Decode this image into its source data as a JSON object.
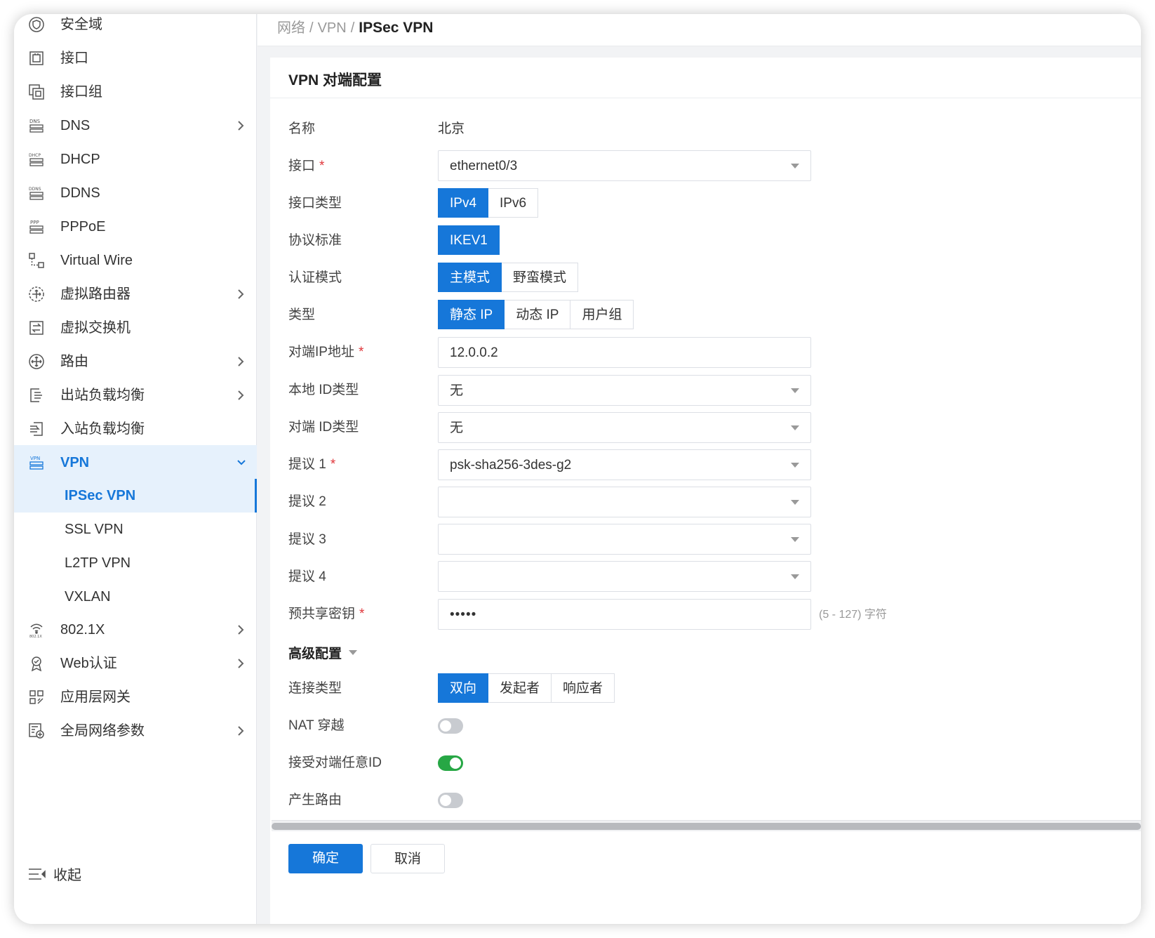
{
  "sidebar": {
    "items": [
      {
        "label": "安全域",
        "icon": "shield-icon"
      },
      {
        "label": "接口",
        "icon": "interface-icon"
      },
      {
        "label": "接口组",
        "icon": "interface-group-icon"
      },
      {
        "label": "DNS",
        "icon": "dns-icon"
      },
      {
        "label": "DHCP",
        "icon": "dhcp-icon"
      },
      {
        "label": "DDNS",
        "icon": "ddns-icon"
      },
      {
        "label": "PPPoE",
        "icon": "pppoe-icon"
      },
      {
        "label": "Virtual Wire",
        "icon": "virtual-wire-icon"
      },
      {
        "label": "虚拟路由器",
        "icon": "virtual-router-icon"
      },
      {
        "label": "虚拟交换机",
        "icon": "virtual-switch-icon"
      },
      {
        "label": "路由",
        "icon": "routing-icon"
      },
      {
        "label": "出站负载均衡",
        "icon": "outbound-lb-icon"
      },
      {
        "label": "入站负载均衡",
        "icon": "inbound-lb-icon"
      },
      {
        "label": "VPN",
        "icon": "vpn-icon"
      },
      {
        "label": "802.1X",
        "icon": "wifi-8021x-icon"
      },
      {
        "label": "Web认证",
        "icon": "web-auth-icon"
      },
      {
        "label": "应用层网关",
        "icon": "app-gateway-icon"
      },
      {
        "label": "全局网络参数",
        "icon": "global-params-icon"
      }
    ],
    "vpn_sub": [
      {
        "label": "IPSec VPN"
      },
      {
        "label": "SSL VPN"
      },
      {
        "label": "L2TP VPN"
      },
      {
        "label": "VXLAN"
      }
    ],
    "collapse_label": "收起"
  },
  "breadcrumb": {
    "part1": "网络",
    "sep": "/",
    "part2": "VPN",
    "current": "IPSec VPN"
  },
  "panel": {
    "title": "VPN 对端配置"
  },
  "form": {
    "name": {
      "label": "名称",
      "value": "北京"
    },
    "interface": {
      "label": "接口",
      "value": "ethernet0/3"
    },
    "interface_type": {
      "label": "接口类型",
      "options": [
        "IPv4",
        "IPv6"
      ],
      "selected": "IPv4"
    },
    "protocol": {
      "label": "协议标准",
      "options": [
        "IKEV1"
      ],
      "selected": "IKEV1"
    },
    "auth_mode": {
      "label": "认证模式",
      "options": [
        "主模式",
        "野蛮模式"
      ],
      "selected": "主模式"
    },
    "type": {
      "label": "类型",
      "options": [
        "静态 IP",
        "动态 IP",
        "用户组"
      ],
      "selected": "静态 IP"
    },
    "peer_ip": {
      "label": "对端IP地址",
      "value": "12.0.0.2"
    },
    "local_id_type": {
      "label": "本地 ID类型",
      "value": "无"
    },
    "peer_id_type": {
      "label": "对端 ID类型",
      "value": "无"
    },
    "proposal1": {
      "label": "提议 1",
      "value": "psk-sha256-3des-g2"
    },
    "proposal2": {
      "label": "提议 2",
      "value": ""
    },
    "proposal3": {
      "label": "提议 3",
      "value": ""
    },
    "proposal4": {
      "label": "提议 4",
      "value": ""
    },
    "psk": {
      "label": "预共享密钥",
      "value": "•••••",
      "hint": "(5 - 127) 字符"
    },
    "advanced": {
      "label": "高级配置"
    },
    "conn_type": {
      "label": "连接类型",
      "options": [
        "双向",
        "发起者",
        "响应者"
      ],
      "selected": "双向"
    },
    "nat": {
      "label": "NAT 穿越",
      "on": false
    },
    "accept_any_id": {
      "label": "接受对端任意ID",
      "on": true
    },
    "gen_route": {
      "label": "产生路由",
      "on": false
    },
    "required_mark": "*"
  },
  "footer": {
    "ok": "确定",
    "cancel": "取消"
  },
  "colors": {
    "accent": "#1677d9",
    "toggle_on": "#27a745",
    "toggle_off": "#c8cbd0",
    "required": "#e0363b"
  }
}
